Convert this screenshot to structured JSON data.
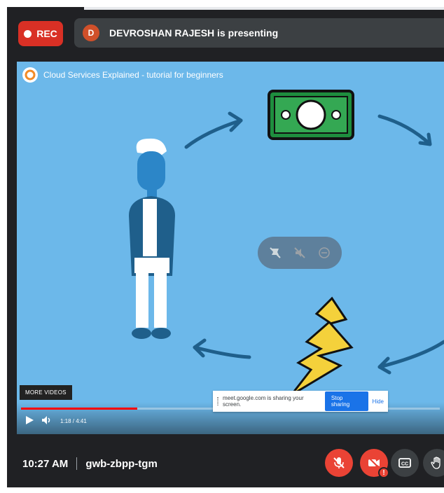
{
  "meet": {
    "rec_label": "REC",
    "presenter_initial": "D",
    "presenting_text": "DEVROSHAN RAJESH is presenting",
    "time": "10:27 AM",
    "meeting_code": "gwb-zbpp-tgm",
    "colors": {
      "rec": "#d93025",
      "mic_off": "#ea4335",
      "background": "#202124"
    },
    "controls": [
      {
        "name": "mic-off",
        "icon": "mic-off-icon"
      },
      {
        "name": "camera-off",
        "icon": "video-off-icon",
        "badge": "!"
      },
      {
        "name": "captions",
        "icon": "closed-captions-icon"
      },
      {
        "name": "raise-hand",
        "icon": "hand-icon"
      }
    ]
  },
  "video": {
    "title": "Cloud Services Explained - tutorial for beginners",
    "more_videos": "MORE VIDEOS",
    "time_display": "1:18 / 4:41",
    "progress_fraction": 0.278
  },
  "share_notice": {
    "text": "meet.google.com is sharing your screen.",
    "stop_label": "Stop sharing",
    "hide_label": "Hide"
  }
}
